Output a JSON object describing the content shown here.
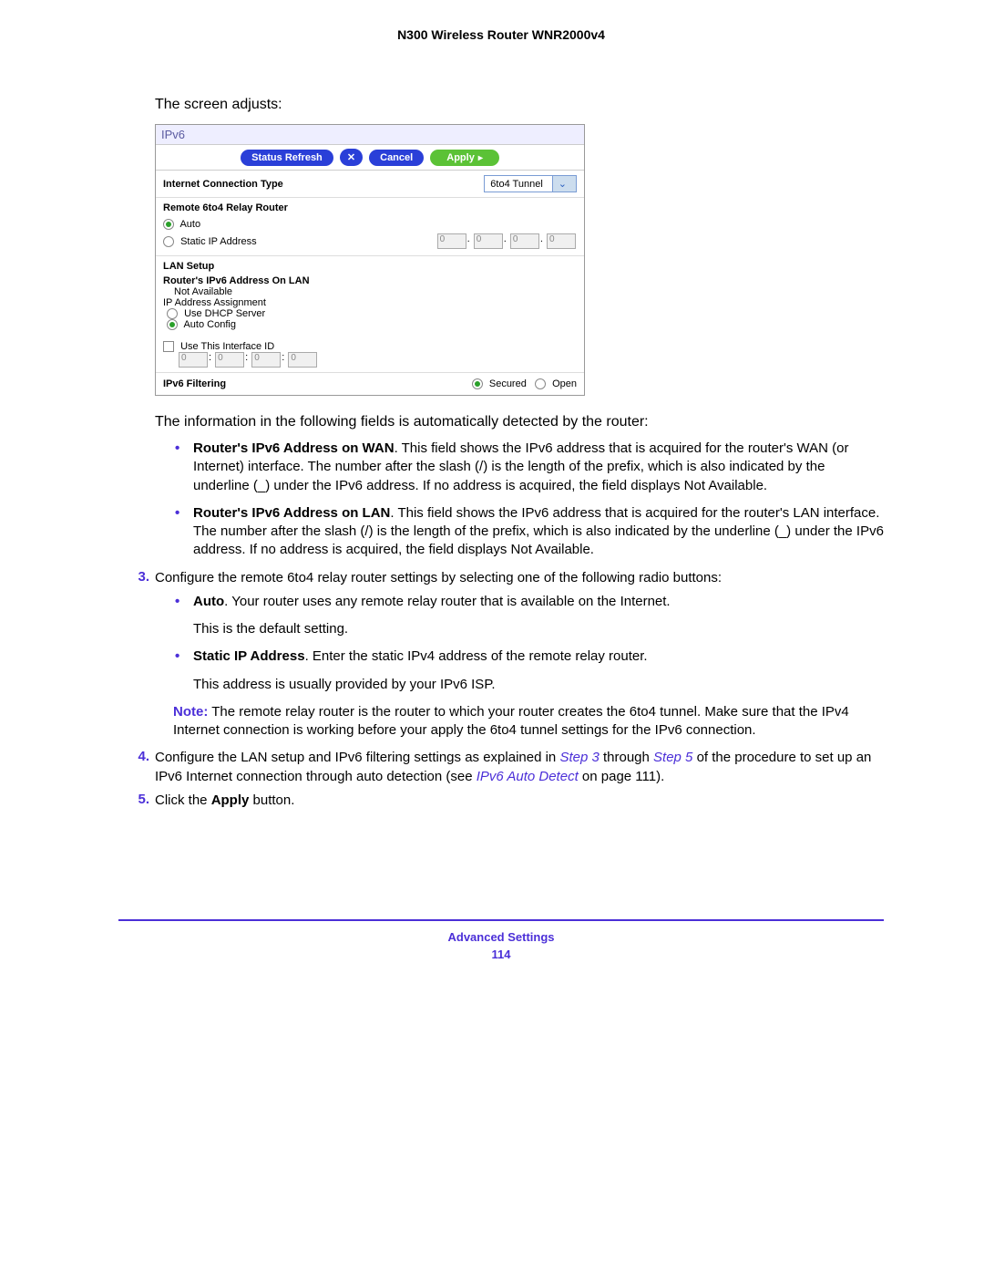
{
  "header": {
    "title": "N300 Wireless Router WNR2000v4"
  },
  "intro": "The screen adjusts:",
  "screenshot": {
    "panel_title": "IPv6",
    "buttons": {
      "refresh": "Status Refresh",
      "cancel_x": "✕",
      "cancel": "Cancel",
      "apply": "Apply"
    },
    "conn_type_label": "Internet Connection Type",
    "conn_type_value": "6to4 Tunnel",
    "relay": {
      "title": "Remote 6to4 Relay Router",
      "auto": "Auto",
      "static": "Static IP Address",
      "ip": [
        "0",
        "0",
        "0",
        "0"
      ]
    },
    "lan": {
      "title": "LAN Setup",
      "addr_label": "Router's IPv6 Address On LAN",
      "addr_value": "Not Available",
      "assign_label": "IP Address Assignment",
      "dhcp": "Use DHCP Server",
      "auto_config": "Auto Config",
      "use_interface": "Use This Interface ID",
      "interface_ip": [
        "0",
        "0",
        "0",
        "0"
      ]
    },
    "filter": {
      "label": "IPv6 Filtering",
      "secured": "Secured",
      "open": "Open"
    }
  },
  "auto_detected_intro": "The information in the following fields is automatically detected by the router:",
  "bullets1": [
    {
      "bold": "Router's IPv6 Address on WAN",
      "rest": ". This field shows the IPv6 address that is acquired for the router's WAN (or Internet) interface. The number after the slash (/) is the length of the prefix, which is also indicated by the underline (_) under the IPv6 address. If no address is acquired, the field displays Not Available."
    },
    {
      "bold": "Router's IPv6 Address on LAN",
      "rest": ". This field shows the IPv6 address that is acquired for the router's LAN interface. The number after the slash (/) is the length of the prefix, which is also indicated by the underline (_) under the IPv6 address. If no address is acquired, the field displays Not Available."
    }
  ],
  "step3": {
    "num": "3.",
    "text": "Configure the remote 6to4 relay router settings by selecting one of the following radio buttons:"
  },
  "bullets2": [
    {
      "bold": "Auto",
      "rest": ". Your router uses any remote relay router that is available on the Internet.",
      "follow": "This is the default setting."
    },
    {
      "bold": "Static IP Address",
      "rest": ". Enter the static IPv4 address of the remote relay router.",
      "follow": "This address is usually provided by your IPv6 ISP."
    }
  ],
  "note": {
    "label": "Note:",
    "text": "The remote relay router is the router to which your router creates the 6to4 tunnel. Make sure that the IPv4 Internet connection is working before your apply the 6to4 tunnel settings for the IPv6 connection."
  },
  "step4": {
    "num": "4.",
    "pre": "Configure the LAN setup and IPv6 filtering settings as explained in ",
    "ref1": "Step 3",
    "mid1": " through ",
    "ref2": "Step 5",
    "mid2": " of the procedure to set up an IPv6 Internet connection through auto detection (see ",
    "ref3": "IPv6 Auto Detect",
    "post": " on page 111)."
  },
  "step5": {
    "num": "5.",
    "pre": "Click the ",
    "bold": "Apply",
    "post": " button."
  },
  "footer": {
    "section": "Advanced Settings",
    "page": "114"
  }
}
